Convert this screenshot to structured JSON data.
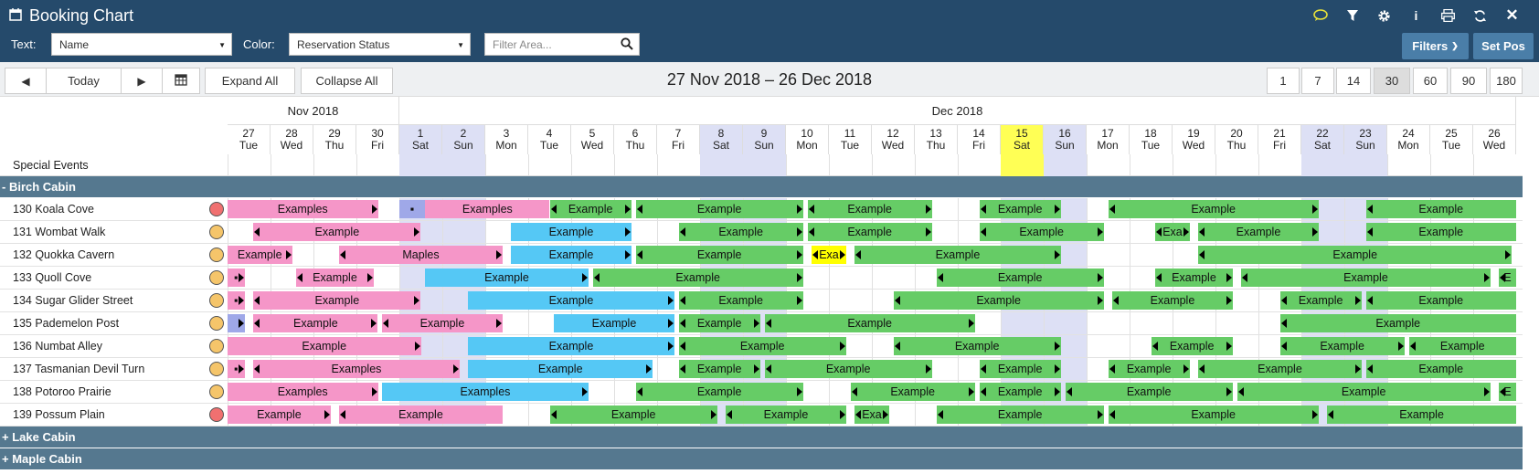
{
  "title": "Booking Chart",
  "icons": [
    "calendar-icon",
    "chat-icon",
    "filter-icon",
    "gear-icon",
    "info-icon",
    "print-icon",
    "refresh-icon",
    "close-icon"
  ],
  "filters": {
    "text_label": "Text:",
    "text_value": "Name",
    "color_label": "Color:",
    "color_value": "Reservation Status",
    "filter_placeholder": "Filter Area...",
    "filters_btn": "Filters",
    "setpos_btn": "Set Pos"
  },
  "nav": {
    "today": "Today",
    "expand": "Expand All",
    "collapse": "Collapse All",
    "range": "27 Nov 2018 – 26 Dec 2018",
    "zooms": [
      "1",
      "7",
      "14",
      "30",
      "60",
      "90",
      "180"
    ],
    "active_zoom": "30"
  },
  "months": [
    {
      "label": "Nov 2018",
      "days": 4
    },
    {
      "label": "Dec 2018",
      "days": 26
    }
  ],
  "days": [
    {
      "d": "27",
      "w": "Tue"
    },
    {
      "d": "28",
      "w": "Wed"
    },
    {
      "d": "29",
      "w": "Thu"
    },
    {
      "d": "30",
      "w": "Fri"
    },
    {
      "d": "1",
      "w": "Sat",
      "we": true
    },
    {
      "d": "2",
      "w": "Sun",
      "we": true
    },
    {
      "d": "3",
      "w": "Mon"
    },
    {
      "d": "4",
      "w": "Tue"
    },
    {
      "d": "5",
      "w": "Wed"
    },
    {
      "d": "6",
      "w": "Thu"
    },
    {
      "d": "7",
      "w": "Fri"
    },
    {
      "d": "8",
      "w": "Sat",
      "we": true
    },
    {
      "d": "9",
      "w": "Sun",
      "we": true
    },
    {
      "d": "10",
      "w": "Mon"
    },
    {
      "d": "11",
      "w": "Tue"
    },
    {
      "d": "12",
      "w": "Wed"
    },
    {
      "d": "13",
      "w": "Thu"
    },
    {
      "d": "14",
      "w": "Fri"
    },
    {
      "d": "15",
      "w": "Sat",
      "we": true,
      "today": true
    },
    {
      "d": "16",
      "w": "Sun",
      "we": true
    },
    {
      "d": "17",
      "w": "Mon"
    },
    {
      "d": "18",
      "w": "Tue"
    },
    {
      "d": "19",
      "w": "Wed"
    },
    {
      "d": "20",
      "w": "Thu"
    },
    {
      "d": "21",
      "w": "Fri"
    },
    {
      "d": "22",
      "w": "Sat",
      "we": true
    },
    {
      "d": "23",
      "w": "Sun",
      "we": true
    },
    {
      "d": "24",
      "w": "Mon"
    },
    {
      "d": "25",
      "w": "Tue"
    },
    {
      "d": "26",
      "w": "Wed"
    }
  ],
  "special_events_label": "Special Events",
  "colors": {
    "pink": "#f596c8",
    "blue": "#55c8f5",
    "green": "#66cc66",
    "yellow": "#ffff00",
    "purple": "#9fa8e8",
    "red_dot": "#f07070",
    "orange_dot": "#f5c56a",
    "weekend": "#dde0f5",
    "today": "#ffff55"
  },
  "groups": [
    {
      "label": "- Birch Cabin",
      "expanded": true
    },
    {
      "label": "+ Lake Cabin",
      "expanded": false
    },
    {
      "label": "+ Maple Cabin",
      "expanded": false
    }
  ],
  "rooms": [
    {
      "name": "130 Koala Cove",
      "status": "red",
      "bars": [
        {
          "s": 0,
          "e": 3.5,
          "c": "pink",
          "t": "Examples",
          "ra": true
        },
        {
          "s": 4,
          "e": 4.6,
          "c": "purple",
          "t": "▪"
        },
        {
          "s": 4.6,
          "e": 7.5,
          "c": "pink",
          "t": "Examples"
        },
        {
          "s": 7.5,
          "e": 9.4,
          "c": "green",
          "t": "Example",
          "la": true,
          "ra": true
        },
        {
          "s": 9.5,
          "e": 13.4,
          "c": "green",
          "t": "Example",
          "la": true,
          "ra": true
        },
        {
          "s": 13.5,
          "e": 16.4,
          "c": "green",
          "t": "Example",
          "la": true,
          "ra": true
        },
        {
          "s": 17.5,
          "e": 19.4,
          "c": "green",
          "t": "Example",
          "la": true,
          "ra": true
        },
        {
          "s": 20.5,
          "e": 25.4,
          "c": "green",
          "t": "Example",
          "la": true,
          "ra": true
        },
        {
          "s": 26.5,
          "e": 30,
          "c": "green",
          "t": "Example",
          "la": true
        }
      ]
    },
    {
      "name": "131 Wombat Walk",
      "status": "orange",
      "bars": [
        {
          "s": 0.6,
          "e": 4.5,
          "c": "pink",
          "t": "Example",
          "la": true,
          "ra": true
        },
        {
          "s": 6.6,
          "e": 9.4,
          "c": "blue",
          "t": "Example",
          "ra": true
        },
        {
          "s": 10.5,
          "e": 13.4,
          "c": "green",
          "t": "Example",
          "la": true,
          "ra": true
        },
        {
          "s": 13.5,
          "e": 16.4,
          "c": "green",
          "t": "Example",
          "la": true,
          "ra": true
        },
        {
          "s": 17.5,
          "e": 20.4,
          "c": "green",
          "t": "Example",
          "la": true,
          "ra": true
        },
        {
          "s": 21.6,
          "e": 22.4,
          "c": "green",
          "t": "Exa",
          "la": true,
          "ra": true
        },
        {
          "s": 22.6,
          "e": 25.4,
          "c": "green",
          "t": "Example",
          "la": true,
          "ra": true
        },
        {
          "s": 26.5,
          "e": 30,
          "c": "green",
          "t": "Example",
          "la": true
        }
      ]
    },
    {
      "name": "132 Quokka Cavern",
      "status": "orange",
      "bars": [
        {
          "s": 0,
          "e": 1.5,
          "c": "pink",
          "t": "Example",
          "ra": true
        },
        {
          "s": 2.6,
          "e": 6.4,
          "c": "pink",
          "t": "Maples",
          "la": true,
          "ra": true
        },
        {
          "s": 6.6,
          "e": 9.4,
          "c": "blue",
          "t": "Example",
          "ra": true
        },
        {
          "s": 9.5,
          "e": 13.4,
          "c": "green",
          "t": "Example",
          "la": true,
          "ra": true
        },
        {
          "s": 13.6,
          "e": 14.4,
          "c": "yellow",
          "t": "Exa",
          "la": true,
          "ra": true
        },
        {
          "s": 14.6,
          "e": 19.4,
          "c": "green",
          "t": "Example",
          "la": true,
          "ra": true
        },
        {
          "s": 22.6,
          "e": 29.9,
          "c": "green",
          "t": "Example",
          "la": true,
          "ra": true
        }
      ]
    },
    {
      "name": "133 Quoll Cove",
      "status": "orange",
      "bars": [
        {
          "s": 0,
          "e": 0.4,
          "c": "pink",
          "t": "▪",
          "ra": true
        },
        {
          "s": 1.6,
          "e": 3.4,
          "c": "pink",
          "t": "Example",
          "la": true,
          "ra": true
        },
        {
          "s": 4.6,
          "e": 8.4,
          "c": "blue",
          "t": "Example",
          "ra": true
        },
        {
          "s": 8.5,
          "e": 13.4,
          "c": "green",
          "t": "Example",
          "la": true,
          "ra": true
        },
        {
          "s": 16.5,
          "e": 20.4,
          "c": "green",
          "t": "Example",
          "la": true,
          "ra": true
        },
        {
          "s": 21.6,
          "e": 23.4,
          "c": "green",
          "t": "Example",
          "la": true,
          "ra": true
        },
        {
          "s": 23.6,
          "e": 29.4,
          "c": "green",
          "t": "Example",
          "la": true,
          "ra": true
        },
        {
          "s": 29.6,
          "e": 30,
          "c": "green",
          "t": "E",
          "la": true
        }
      ]
    },
    {
      "name": "134 Sugar Glider Street",
      "status": "orange",
      "bars": [
        {
          "s": 0,
          "e": 0.4,
          "c": "pink",
          "t": "▪",
          "ra": true
        },
        {
          "s": 0.6,
          "e": 4.5,
          "c": "pink",
          "t": "Example",
          "la": true,
          "ra": true
        },
        {
          "s": 5.6,
          "e": 10.4,
          "c": "blue",
          "t": "Example",
          "ra": true
        },
        {
          "s": 10.5,
          "e": 13.4,
          "c": "green",
          "t": "Example",
          "la": true,
          "ra": true
        },
        {
          "s": 15.5,
          "e": 20.4,
          "c": "green",
          "t": "Example",
          "la": true,
          "ra": true
        },
        {
          "s": 20.6,
          "e": 23.4,
          "c": "green",
          "t": "Example",
          "la": true,
          "ra": true
        },
        {
          "s": 24.5,
          "e": 26.4,
          "c": "green",
          "t": "Example",
          "la": true,
          "ra": true
        },
        {
          "s": 26.5,
          "e": 30,
          "c": "green",
          "t": "Example",
          "la": true
        }
      ]
    },
    {
      "name": "135 Pademelon Post",
      "status": "orange",
      "bars": [
        {
          "s": 0,
          "e": 0.4,
          "c": "purple",
          "t": "",
          "ra": true
        },
        {
          "s": 0.6,
          "e": 3.5,
          "c": "pink",
          "t": "Example",
          "la": true,
          "ra": true
        },
        {
          "s": 3.6,
          "e": 6.4,
          "c": "pink",
          "t": "Example",
          "la": true,
          "ra": true
        },
        {
          "s": 7.6,
          "e": 10.4,
          "c": "blue",
          "t": "Example",
          "ra": true
        },
        {
          "s": 10.5,
          "e": 12.4,
          "c": "green",
          "t": "Example",
          "la": true,
          "ra": true
        },
        {
          "s": 12.5,
          "e": 17.4,
          "c": "green",
          "t": "Example",
          "la": true,
          "ra": true
        },
        {
          "s": 24.5,
          "e": 30,
          "c": "green",
          "t": "Example",
          "la": true
        }
      ]
    },
    {
      "name": "136 Numbat Alley",
      "status": "orange",
      "bars": [
        {
          "s": 0,
          "e": 4.5,
          "c": "pink",
          "t": "Example",
          "ra": true
        },
        {
          "s": 5.6,
          "e": 10.4,
          "c": "blue",
          "t": "Example",
          "ra": true
        },
        {
          "s": 10.5,
          "e": 14.4,
          "c": "green",
          "t": "Example",
          "la": true,
          "ra": true
        },
        {
          "s": 15.5,
          "e": 19.4,
          "c": "green",
          "t": "Example",
          "la": true,
          "ra": true
        },
        {
          "s": 21.5,
          "e": 23.4,
          "c": "green",
          "t": "Example",
          "la": true,
          "ra": true
        },
        {
          "s": 24.5,
          "e": 27.4,
          "c": "green",
          "t": "Example",
          "la": true,
          "ra": true
        },
        {
          "s": 27.5,
          "e": 30,
          "c": "green",
          "t": "Example",
          "la": true
        }
      ]
    },
    {
      "name": "137 Tasmanian Devil Turn",
      "status": "orange",
      "bars": [
        {
          "s": 0,
          "e": 0.4,
          "c": "pink",
          "t": "▪",
          "ra": true
        },
        {
          "s": 0.6,
          "e": 5.4,
          "c": "pink",
          "t": "Examples",
          "la": true,
          "ra": true
        },
        {
          "s": 5.6,
          "e": 9.9,
          "c": "blue",
          "t": "Example",
          "ra": true
        },
        {
          "s": 10.5,
          "e": 12.4,
          "c": "green",
          "t": "Example",
          "la": true,
          "ra": true
        },
        {
          "s": 12.5,
          "e": 16.4,
          "c": "green",
          "t": "Example",
          "la": true,
          "ra": true
        },
        {
          "s": 17.5,
          "e": 19.4,
          "c": "green",
          "t": "Example",
          "la": true,
          "ra": true
        },
        {
          "s": 20.5,
          "e": 22.4,
          "c": "green",
          "t": "Example",
          "la": true,
          "ra": true
        },
        {
          "s": 22.6,
          "e": 26.4,
          "c": "green",
          "t": "Example",
          "la": true,
          "ra": true
        },
        {
          "s": 26.5,
          "e": 30,
          "c": "green",
          "t": "Example",
          "la": true
        }
      ]
    },
    {
      "name": "138 Potoroo Prairie",
      "status": "orange",
      "bars": [
        {
          "s": 0,
          "e": 3.5,
          "c": "pink",
          "t": "Examples",
          "ra": true
        },
        {
          "s": 3.6,
          "e": 8.4,
          "c": "blue",
          "t": "Examples",
          "ra": true
        },
        {
          "s": 9.5,
          "e": 13.4,
          "c": "green",
          "t": "Example",
          "la": true,
          "ra": true
        },
        {
          "s": 14.5,
          "e": 17.4,
          "c": "green",
          "t": "Example",
          "la": true,
          "ra": true
        },
        {
          "s": 17.5,
          "e": 19.4,
          "c": "green",
          "t": "Example",
          "la": true,
          "ra": true
        },
        {
          "s": 19.5,
          "e": 23.4,
          "c": "green",
          "t": "Example",
          "la": true,
          "ra": true
        },
        {
          "s": 23.5,
          "e": 29.4,
          "c": "green",
          "t": "Example",
          "la": true,
          "ra": true
        },
        {
          "s": 29.6,
          "e": 30,
          "c": "green",
          "t": "E",
          "la": true
        }
      ]
    },
    {
      "name": "139 Possum Plain",
      "status": "red",
      "bars": [
        {
          "s": 0,
          "e": 2.4,
          "c": "pink",
          "t": "Example",
          "ra": true
        },
        {
          "s": 2.6,
          "e": 6.4,
          "c": "pink",
          "t": "Example",
          "la": true
        },
        {
          "s": 7.5,
          "e": 11.4,
          "c": "green",
          "t": "Example",
          "la": true,
          "ra": true
        },
        {
          "s": 11.6,
          "e": 14.4,
          "c": "green",
          "t": "Example",
          "la": true,
          "ra": true
        },
        {
          "s": 14.6,
          "e": 15.4,
          "c": "green",
          "t": "Exa",
          "la": true,
          "ra": true
        },
        {
          "s": 16.5,
          "e": 20.4,
          "c": "green",
          "t": "Example",
          "la": true,
          "ra": true
        },
        {
          "s": 20.5,
          "e": 25.4,
          "c": "green",
          "t": "Example",
          "la": true,
          "ra": true
        },
        {
          "s": 25.6,
          "e": 30,
          "c": "green",
          "t": "Example",
          "la": true
        }
      ]
    }
  ]
}
